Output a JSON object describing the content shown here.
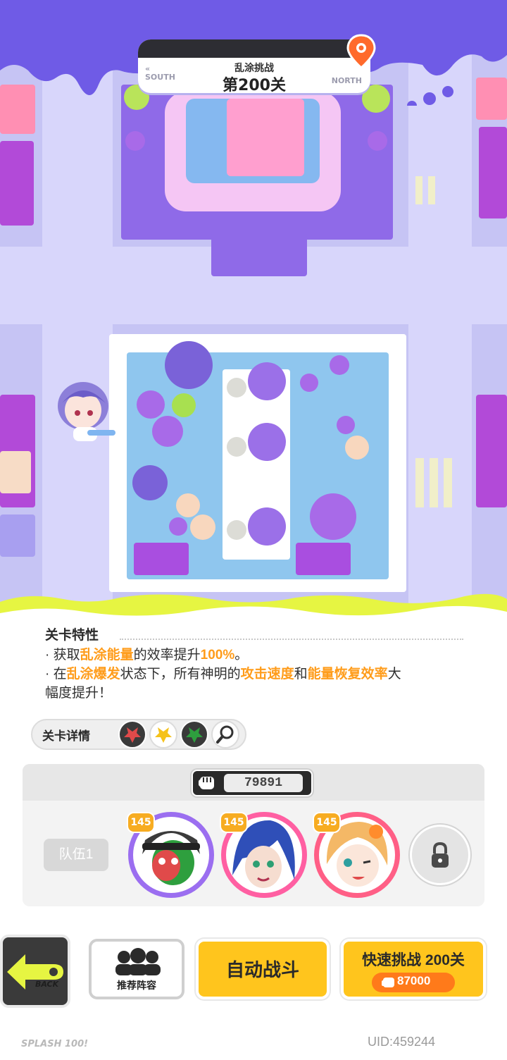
{
  "stage": {
    "mode": "乱涂挑战",
    "title": "第200关",
    "south": "SOUTH",
    "north": "NORTH"
  },
  "traits": {
    "title": "关卡特性",
    "line1_a": "· 获取",
    "line1_hl1": "乱涂能量",
    "line1_b": "的效率提升",
    "line1_hl2": "100%",
    "line1_c": "。",
    "line2_a": "· 在",
    "line2_hl1": "乱涂爆发",
    "line2_b": "状态下，所有神明的",
    "line2_hl2": "攻击速度",
    "line2_c": "和",
    "line2_hl3": "能量恢复效率",
    "line2_d": "大",
    "line3": "幅度提升！"
  },
  "detail": {
    "label": "关卡详情",
    "chips": [
      {
        "color": "#e04a4a",
        "icon": "red-splat-icon"
      },
      {
        "color": "#f5c21b",
        "icon": "yellow-splat-icon"
      },
      {
        "color": "#2e9f3e",
        "icon": "green-splat-icon"
      }
    ],
    "search_icon": "magnifier-icon"
  },
  "team": {
    "power": "79891",
    "label": "队伍1",
    "heroes": [
      {
        "level": "145",
        "bg": "#9b6ef0"
      },
      {
        "level": "145",
        "bg": "#ff5fa2"
      },
      {
        "level": "145",
        "bg": "#ff5f86"
      }
    ]
  },
  "buttons": {
    "back": "BACK",
    "recommend": "推荐阵容",
    "auto": "自动战斗",
    "quick": "快速挑战 200关",
    "quick_cost": "87000"
  },
  "footer": {
    "logo": "SPLASH 100!",
    "uid": "UID:459244"
  },
  "colors": {
    "ink_purple": "#6f5be6",
    "slime_yellow": "#e6f542",
    "accent_orange": "#ff9c1a",
    "button_yellow": "#ffc51d"
  }
}
